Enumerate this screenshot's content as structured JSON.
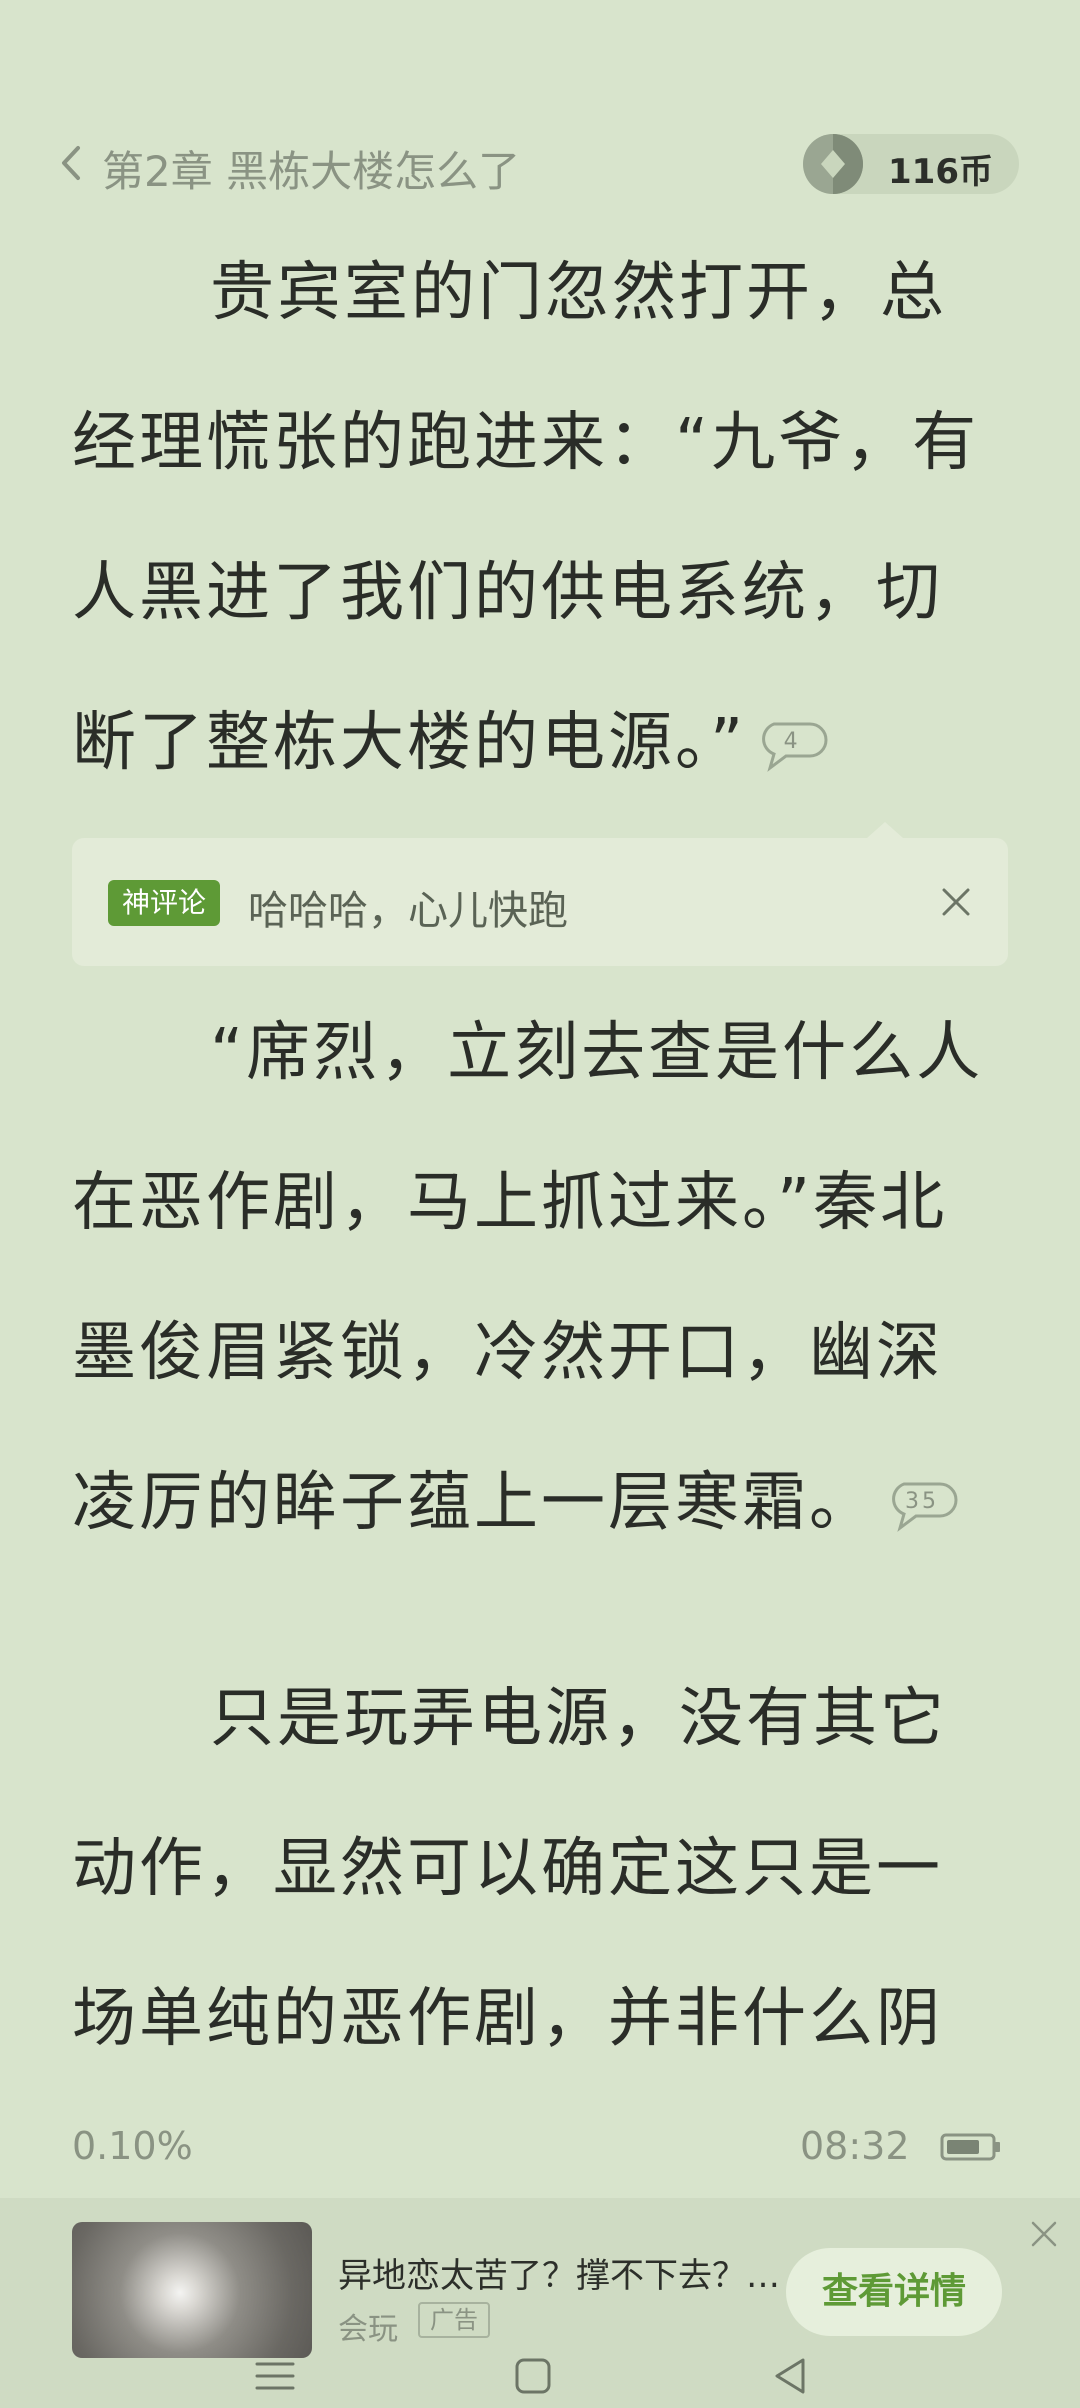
{
  "header": {
    "back_icon": "chevron-left-icon",
    "chapter_title": "第2章 黑栋大楼怎么了",
    "coins": "116币",
    "coin_icon": "coin-icon"
  },
  "paragraphs": [
    {
      "lines": [
        "贵宾室的门忽然打开，总",
        "经理慌张的跑进来：“九爷，有",
        "人黑进了我们的供电系统，切",
        "断了整栋大楼的电源。”"
      ],
      "comment_count": "4"
    },
    {
      "lines": [
        "“席烈，立刻去查是什么人",
        "在恶作剧，马上抓过来。”秦北",
        "墨俊眉紧锁，冷然开口，幽深",
        "凌厉的眸子蕴上一层寒霜。"
      ],
      "comment_count": "35"
    },
    {
      "lines": [
        "只是玩弄电源，没有其它",
        "动作，显然可以确定这只是一",
        "场单纯的恶作剧，并非什么阴"
      ]
    }
  ],
  "hot_comment": {
    "badge": "神评论",
    "text": "哈哈哈，心儿快跑",
    "close_icon": "close-icon"
  },
  "status": {
    "progress_text": "0.10%",
    "time": "08:32",
    "battery_level": 0.75
  },
  "ad": {
    "title": "异地恋太苦了？撑不下去？…",
    "source": "会玩",
    "tag": "广告",
    "button": "查看详情"
  },
  "colors": {
    "background": "#d8e4cc",
    "accent_green": "#5e9a36",
    "muted_text": "#8a9383"
  }
}
